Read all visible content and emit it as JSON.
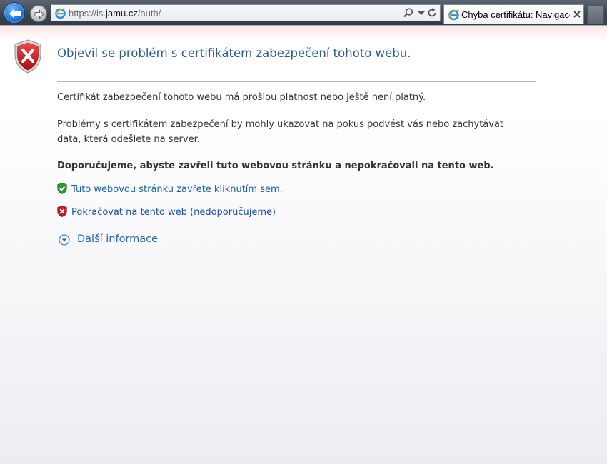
{
  "browser": {
    "url_prefix": "https://is.",
    "url_domain": "jamu.cz",
    "url_path": "/auth/",
    "tab_title": "Chyba certifikátu: Navigace…",
    "icons": [
      "back-icon",
      "forward-icon",
      "ie-logo-icon",
      "search-icon",
      "chevron-down-icon",
      "refresh-icon",
      "close-icon"
    ]
  },
  "page": {
    "heading": "Objevil se problém s certifikátem zabezpečení tohoto webu.",
    "paragraph1": "Certifikát zabezpečení tohoto webu má prošlou platnost nebo ještě není platný.",
    "paragraph2": "Problémy s certifikátem zabezpečení by mohly ukazovat na pokus podvést vás nebo zachytávat data, která odešlete na server.",
    "recommendation": "Doporučujeme, abyste zavřeli tuto webovou stránku a nepokračovali na tento web.",
    "close_link": "Tuto webovou stránku zavřete kliknutím sem.",
    "continue_link": "Pokračovat na tento web (nedoporučujeme)",
    "more_info": "Další informace",
    "icons": [
      "error-shield-icon",
      "green-shield-icon",
      "red-shield-icon",
      "expand-circle-icon"
    ]
  },
  "colors": {
    "heading": "#2b5a97",
    "link": "#1a5ea8",
    "body_text": "#333333",
    "error_red": "#c8181e",
    "safe_green": "#2e9a2e"
  }
}
